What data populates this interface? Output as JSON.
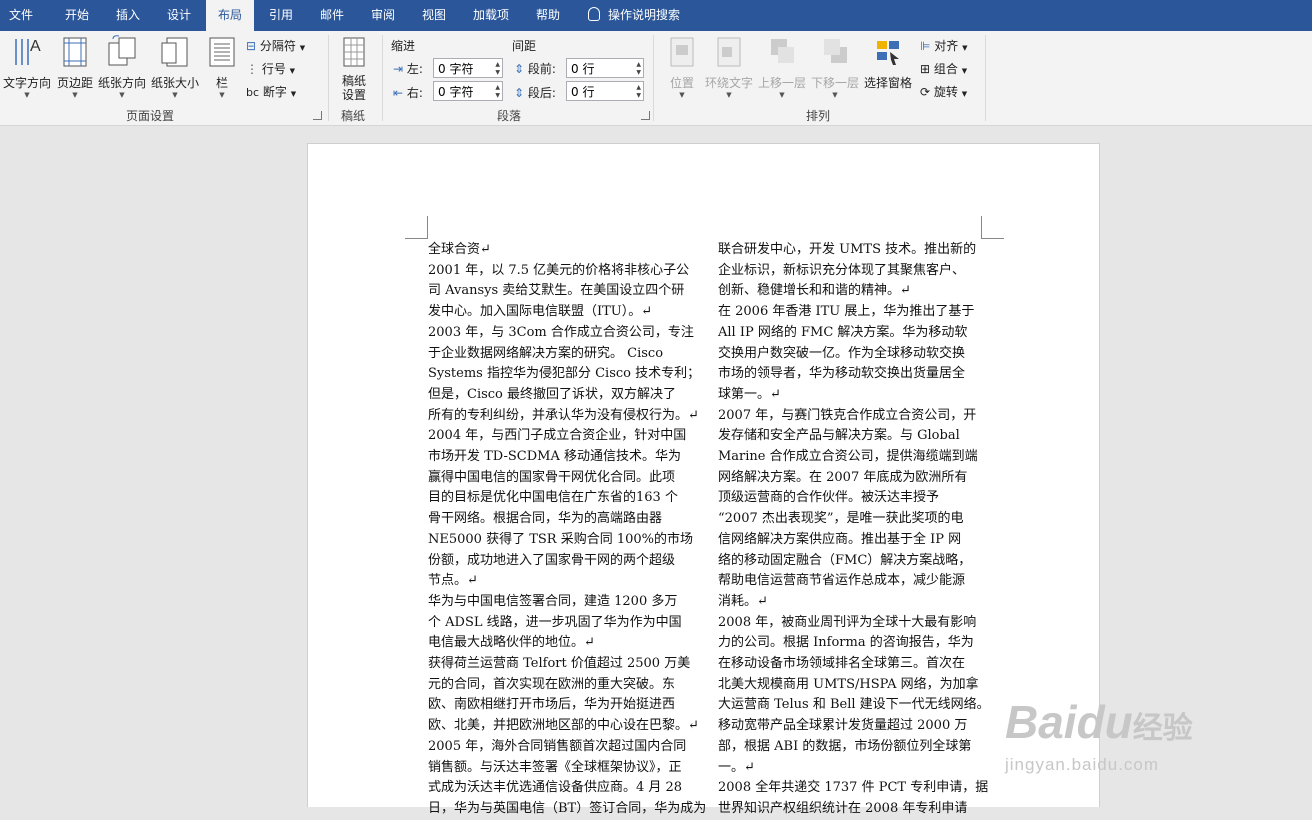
{
  "tabs": [
    "文件",
    "开始",
    "插入",
    "设计",
    "布局",
    "引用",
    "邮件",
    "审阅",
    "视图",
    "加载项",
    "帮助"
  ],
  "active_tab": "布局",
  "tell_me": "操作说明搜索",
  "page_setup": {
    "text_direction": "文字方向",
    "margins": "页边距",
    "orientation": "纸张方向",
    "size": "纸张大小",
    "columns": "栏",
    "breaks": "分隔符",
    "line_numbers": "行号",
    "hyphenation": "断字",
    "group_label": "页面设置"
  },
  "manuscript": {
    "button": "稿纸\n设置",
    "group_label": "稿纸"
  },
  "paragraph": {
    "indent_title": "缩进",
    "spacing_title": "间距",
    "left_label": "左:",
    "left_value": "0 字符",
    "right_label": "右:",
    "right_value": "0 字符",
    "before_label": "段前:",
    "before_value": "0 行",
    "after_label": "段后:",
    "after_value": "0 行",
    "group_label": "段落"
  },
  "arrange": {
    "position": "位置",
    "wrap_text": "环绕文字",
    "bring_forward": "上移一层",
    "send_backward": "下移一层",
    "selection_pane": "选择窗格",
    "align": "对齐",
    "group": "组合",
    "rotate": "旋转",
    "group_label": "排列"
  },
  "document": {
    "left_column": [
      "全球合资↵",
      "2001 年，以 7.5 亿美元的价格将非核心子公",
      "司 Avansys 卖给艾默生。在美国设立四个研",
      "发中心。加入国际电信联盟（ITU）。↵",
      "2003 年，与 3Com 合作成立合资公司，专注",
      "于企业数据网络解决方案的研究。 Cisco",
      "Systems 指控华为侵犯部分  Cisco 技术专利；",
      "但是，Cisco 最终撤回了诉状，双方解决了",
      "所有的专利纠纷，并承认华为没有侵权行为。↵",
      "2004 年，与西门子成立合资企业，针对中国",
      "市场开发 TD-SCDMA 移动通信技术。华为",
      "赢得中国电信的国家骨干网优化合同。此项",
      "目的目标是优化中国电信在广东省的163 个",
      "骨干网络。根据合同，华为的高端路由器",
      "NE5000 获得了 TSR 采购合同 100%的市场",
      "份额，成功地进入了国家骨干网的两个超级",
      "节点。↵",
      "华为与中国电信签署合同，建造 1200 多万",
      "个 ADSL 线路，进一步巩固了华为作为中国",
      "电信最大战略伙伴的地位。↵",
      "获得荷兰运营商 Telfort 价值超过 2500 万美",
      "元的合同，首次实现在欧洲的重大突破。东",
      "欧、南欧相继打开市场后，华为开始挺进西",
      "欧、北美，并把欧洲地区部的中心设在巴黎。↵",
      "2005 年，海外合同销售额首次超过国内合同",
      "销售额。与沃达丰签署《全球框架协议》，正",
      "式成为沃达丰优选通信设备供应商。4 月 28",
      "日，华为与英国电信（BT）签订合同，华为成为"
    ],
    "right_column": [
      "联合研发中心，开发 UMTS 技术。推出新的",
      "企业标识，新标识充分体现了其聚焦客户、",
      "创新、稳健增长和和谐的精神。↵",
      "在 2006 年香港 ITU 展上，华为推出了基于",
      "All IP 网络的 FMC 解决方案。华为移动软",
      "交换用户数突破一亿。作为全球移动软交换",
      "市场的领导者，华为移动软交换出货量居全",
      "球第一。↵",
      "2007 年，与赛门铁克合作成立合资公司，开",
      "发存储和安全产品与解决方案。与 Global",
      "Marine 合作成立合资公司，提供海缆端到端",
      "网络解决方案。在 2007 年底成为欧洲所有",
      "顶级运营商的合作伙伴。被沃达丰授予",
      "“2007 杰出表现奖”，是唯一获此奖项的电",
      "信网络解决方案供应商。推出基于全 IP 网",
      "络的移动固定融合（FMC）解决方案战略，",
      "帮助电信运营商节省运作总成本，减少能源",
      "消耗。↵",
      "2008 年，被商业周刊评为全球十大最有影响",
      "力的公司。根据 Informa 的咨询报告，华为",
      "在移动设备市场领域排名全球第三。首次在",
      "北美大规模商用 UMTS/HSPA 网络，为加拿",
      "大运营商 Telus 和 Bell 建设下一代无线网络。",
      "移动宽带产品全球累计发货量超过 2000 万",
      "部，根据 ABI 的数据，市场份额位列全球第",
      "一。↵",
      "2008 全年共递交 1737 件 PCT 专利申请，据",
      "世界知识产权组织统计在 2008 年专利申请"
    ]
  },
  "watermark": {
    "brand": "Baidu",
    "brand_cn": "经验",
    "url": "jingyan.baidu.com"
  }
}
